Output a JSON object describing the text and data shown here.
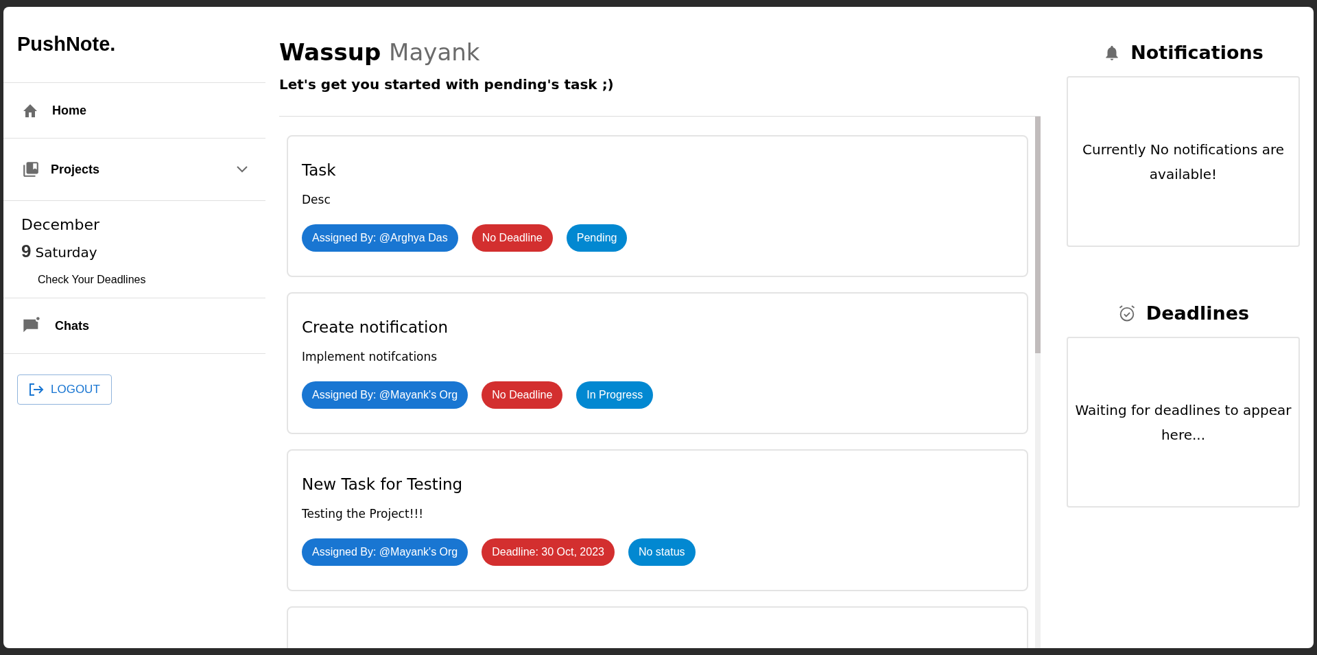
{
  "sidebar": {
    "brand": "PushNote.",
    "nav": [
      {
        "kind": "link",
        "label": "Home"
      },
      {
        "kind": "dropdown",
        "label": "Projects",
        "expanded": false
      },
      {
        "kind": "date",
        "month": "December",
        "day": "9",
        "weekday": "Saturday",
        "link": "Check Your Deadlines"
      },
      {
        "kind": "link",
        "label": "Chats"
      }
    ],
    "logout": "LOGOUT"
  },
  "greeting": {
    "word": "Wassup",
    "name": "Mayank",
    "subtitle": "Let's get you started with pending's task ;)"
  },
  "tasks": [
    {
      "kind": "card",
      "title": "Task",
      "description": "Desc",
      "chips": [
        {
          "text": "Assigned By: @Arghya Das",
          "color": "#1976d2"
        },
        {
          "text": "No Deadline",
          "color": "#d32f2f"
        },
        {
          "text": "Pending",
          "color": "#0288d1"
        }
      ]
    },
    {
      "kind": "card",
      "title": "Create notification",
      "description": "Implement notifcations",
      "chips": [
        {
          "text": "Assigned By: @Mayank's Org",
          "color": "#1976d2"
        },
        {
          "text": "No Deadline",
          "color": "#d32f2f"
        },
        {
          "text": "In Progress",
          "color": "#0288d1"
        }
      ]
    },
    {
      "kind": "card",
      "title": "New Task for Testing",
      "description": "Testing the Project!!!",
      "chips": [
        {
          "text": "Assigned By: @Mayank's Org",
          "color": "#1976d2"
        },
        {
          "text": "Deadline: 30 Oct, 2023",
          "color": "#d32f2f"
        },
        {
          "text": "No status",
          "color": "#0288d1"
        }
      ]
    },
    {
      "kind": "clipped"
    }
  ],
  "panels": [
    {
      "title": "Notifications",
      "message": "Currently No notifications are available!"
    },
    {
      "title": "Deadlines",
      "message": "Waiting for deadlines to appear here..."
    }
  ]
}
